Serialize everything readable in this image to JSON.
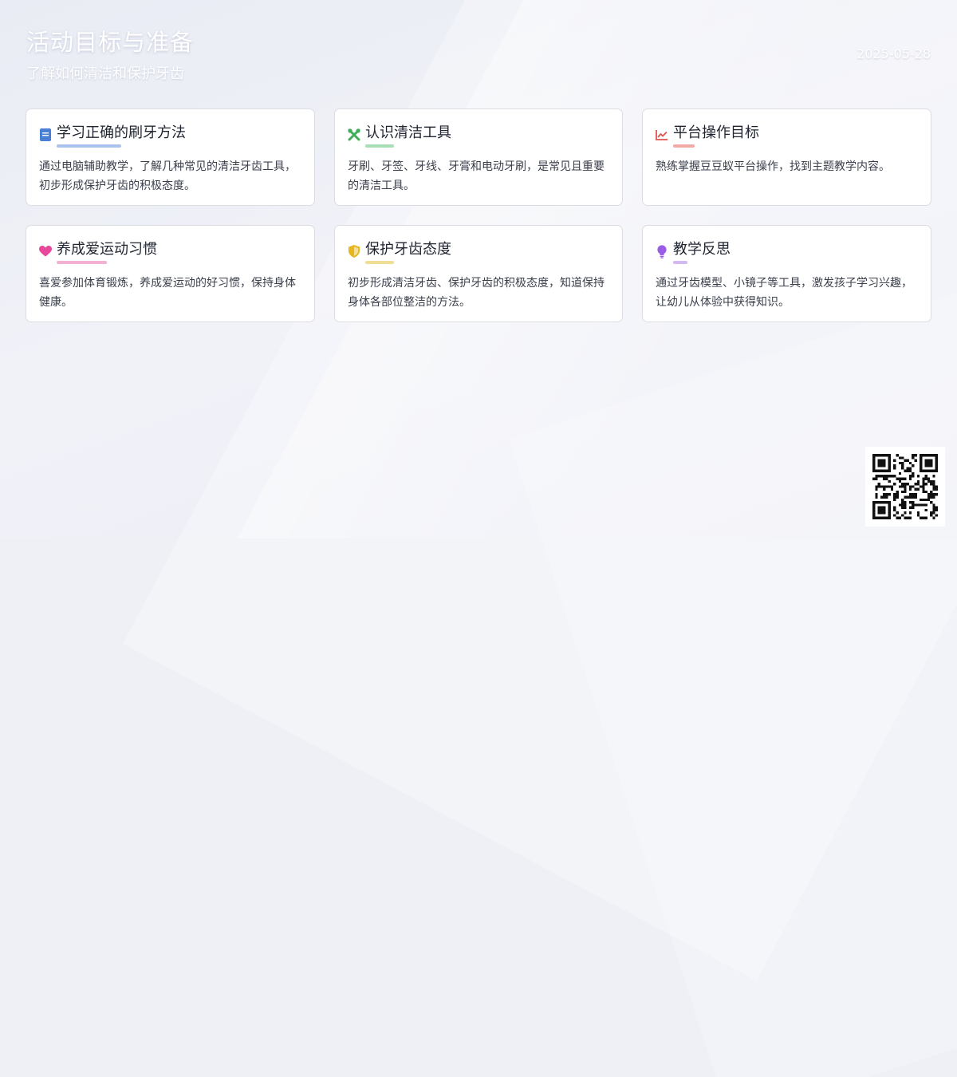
{
  "header": {
    "title": "活动目标与准备",
    "subtitle": "了解如何清洁和保护牙齿",
    "date": "2025-05-28"
  },
  "cards": [
    {
      "title": "学习正确的刷牙方法",
      "description": "通过电脑辅助教学，了解几种常见的清洁牙齿工具，初步形成保护牙齿的积极态度。",
      "icon": "book-icon",
      "color": "#4a7fd6",
      "underline_color": "#a9c3ee"
    },
    {
      "title": "认识清洁工具",
      "description": "牙刷、牙签、牙线、牙膏和电动牙刷，是常见且重要的清洁工具。",
      "icon": "tools-icon",
      "color": "#3fae5b",
      "underline_color": "#a6dfb5"
    },
    {
      "title": "平台操作目标",
      "description": "熟练掌握豆豆蚁平台操作，找到主题教学内容。",
      "icon": "chart-line-icon",
      "color": "#e0534a",
      "underline_color": "#f1aaa6"
    },
    {
      "title": "养成爱运动习惯",
      "description": "喜爱参加体育锻炼，养成爱运动的好习惯，保持身体健康。",
      "icon": "heart-icon",
      "color": "#e8479a",
      "underline_color": "#f2b0d2"
    },
    {
      "title": "保护牙齿态度",
      "description": "初步形成清洁牙齿、保护牙齿的积极态度，知道保持身体各部位整洁的方法。",
      "icon": "shield-icon",
      "color": "#e6b81f",
      "underline_color": "#f0dd96"
    },
    {
      "title": "教学反思",
      "description": "通过牙齿模型、小镜子等工具，激发孩子学习兴趣，让幼儿从体验中获得知识。",
      "icon": "lightbulb-icon",
      "color": "#9b5de5",
      "underline_color": "#d3b8f3"
    }
  ],
  "qr": {
    "icon": "qr-code-icon"
  }
}
